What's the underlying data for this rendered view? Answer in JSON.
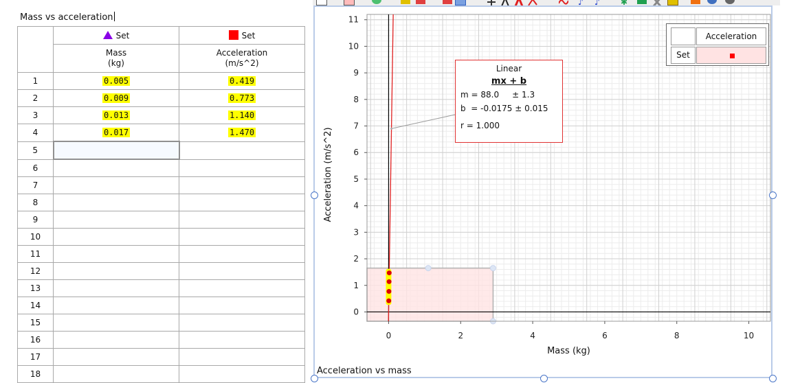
{
  "table": {
    "title": "Mass vs acceleration",
    "columns": [
      {
        "set_label": "Set",
        "marker": "purple-triangle",
        "marker_color": "#8a00e6",
        "name": "Mass",
        "unit": "(kg)"
      },
      {
        "set_label": "Set",
        "marker": "red-square",
        "marker_color": "#ff0000",
        "name": "Acceleration",
        "unit": "(m/s^2)"
      }
    ],
    "row_numbers": [
      "1",
      "2",
      "3",
      "4",
      "5",
      "6",
      "7",
      "8",
      "9",
      "10",
      "11",
      "12",
      "13",
      "14",
      "15",
      "16",
      "17",
      "18"
    ],
    "rows": [
      [
        "0.005",
        "0.419"
      ],
      [
        "0.009",
        "0.773"
      ],
      [
        "0.013",
        "1.140"
      ],
      [
        "0.017",
        "1.470"
      ]
    ],
    "selected_row": 5,
    "highlight_color": "#ffff00"
  },
  "graph": {
    "caption": "Acceleration vs mass",
    "legend": {
      "header": "Acceleration",
      "row_label": "Set"
    },
    "fit": {
      "title": "Linear",
      "equation": "mx + b",
      "m_line": "m = 88.0     ± 1.3",
      "b_line": "b  = -0.0175 ± 0.015",
      "r_line": "r = 1.000"
    }
  },
  "chart_data": {
    "type": "scatter",
    "title": "",
    "xlabel": "Mass (kg)",
    "ylabel": "Acceleration (m/s^2)",
    "xlim": [
      -0.6,
      10.6
    ],
    "ylim": [
      -0.35,
      11.2
    ],
    "xticks": [
      0,
      2,
      4,
      6,
      8,
      10
    ],
    "yticks": [
      0,
      1,
      2,
      3,
      4,
      5,
      6,
      7,
      8,
      9,
      10,
      11
    ],
    "grid": true,
    "legend_position": "top-right",
    "series": [
      {
        "name": "Acceleration",
        "x": [
          0.005,
          0.009,
          0.013,
          0.017
        ],
        "y": [
          0.419,
          0.773,
          1.14,
          1.47
        ],
        "color": "#dd0000"
      }
    ],
    "fit": {
      "type": "linear",
      "m": 88.0,
      "b": -0.0175,
      "color": "#e02020"
    },
    "selection_region": {
      "x": [
        -0.6,
        2.9
      ],
      "y": [
        -0.35,
        1.65
      ],
      "color": "#ffe3e3"
    }
  }
}
